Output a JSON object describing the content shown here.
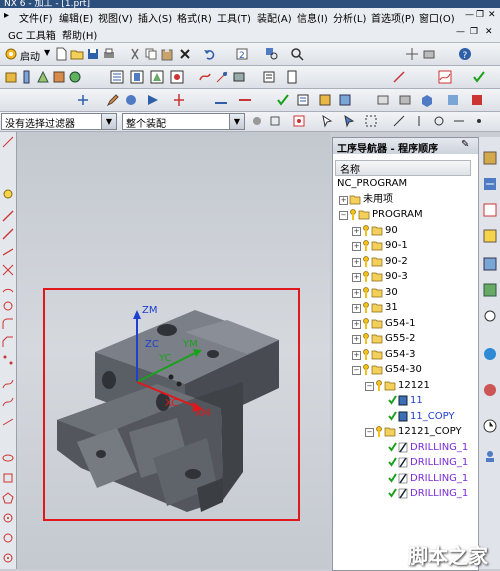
{
  "window": {
    "title": "NX 6 - 加工 - [1.prt]"
  },
  "menu": {
    "items": [
      "文件(F)",
      "编辑(E)",
      "视图(V)",
      "插入(S)",
      "格式(R)",
      "工具(T)",
      "装配(A)",
      "信息(I)",
      "分析(L)",
      "首选项(P)",
      "窗口(O)"
    ]
  },
  "gcbar": {
    "items": [
      "GC 工具箱",
      "帮助(H)"
    ]
  },
  "toolbar1": {
    "start_label": "启动"
  },
  "filterbar": {
    "filter_value": "没有选择过滤器",
    "assembly_value": "整个装配"
  },
  "navigator": {
    "title": "工序导航器 - 程序顺序",
    "column_name": "名称",
    "rows": [
      {
        "label": "NC_PROGRAM",
        "indent": 0,
        "type": "root"
      },
      {
        "label": "未用项",
        "indent": 1,
        "type": "folder",
        "expand": "+"
      },
      {
        "label": "PROGRAM",
        "indent": 1,
        "type": "program",
        "expand": "-"
      },
      {
        "label": "90",
        "indent": 2,
        "type": "program",
        "expand": "+"
      },
      {
        "label": "90-1",
        "indent": 2,
        "type": "program",
        "expand": "+"
      },
      {
        "label": "90-2",
        "indent": 2,
        "type": "program",
        "expand": "+"
      },
      {
        "label": "90-3",
        "indent": 2,
        "type": "program",
        "expand": "+"
      },
      {
        "label": "30",
        "indent": 2,
        "type": "program",
        "expand": "+"
      },
      {
        "label": "31",
        "indent": 2,
        "type": "program",
        "expand": "+"
      },
      {
        "label": "G54-1",
        "indent": 2,
        "type": "program",
        "expand": "+"
      },
      {
        "label": "G55-2",
        "indent": 2,
        "type": "program",
        "expand": "+"
      },
      {
        "label": "G54-3",
        "indent": 2,
        "type": "program",
        "expand": "+"
      },
      {
        "label": "G54-30",
        "indent": 2,
        "type": "program",
        "expand": "-"
      },
      {
        "label": "12121",
        "indent": 3,
        "type": "program",
        "expand": "-"
      },
      {
        "label": "11",
        "indent": 4,
        "type": "op"
      },
      {
        "label": "11_COPY",
        "indent": 4,
        "type": "op"
      },
      {
        "label": "12121_COPY",
        "indent": 3,
        "type": "program",
        "expand": "-"
      },
      {
        "label": "DRILLING_1",
        "indent": 4,
        "type": "drill"
      },
      {
        "label": "DRILLING_1",
        "indent": 4,
        "type": "drill"
      },
      {
        "label": "DRILLING_1",
        "indent": 4,
        "type": "drill"
      },
      {
        "label": "DRILLING_1",
        "indent": 4,
        "type": "drill"
      }
    ]
  },
  "viewport": {
    "axis_labels": [
      "ZM",
      "ZC",
      "YC",
      "YM",
      "XC",
      "XM"
    ]
  },
  "watermark": {
    "site": "jb51.net",
    "name": "脚本之家"
  },
  "colors": {
    "accent_red": "#e0181c",
    "title_blue": "#2d4f7c",
    "check_green": "#1aa11a",
    "key_yellow": "#f2c21b",
    "drill_purple": "#7a2bd6"
  }
}
